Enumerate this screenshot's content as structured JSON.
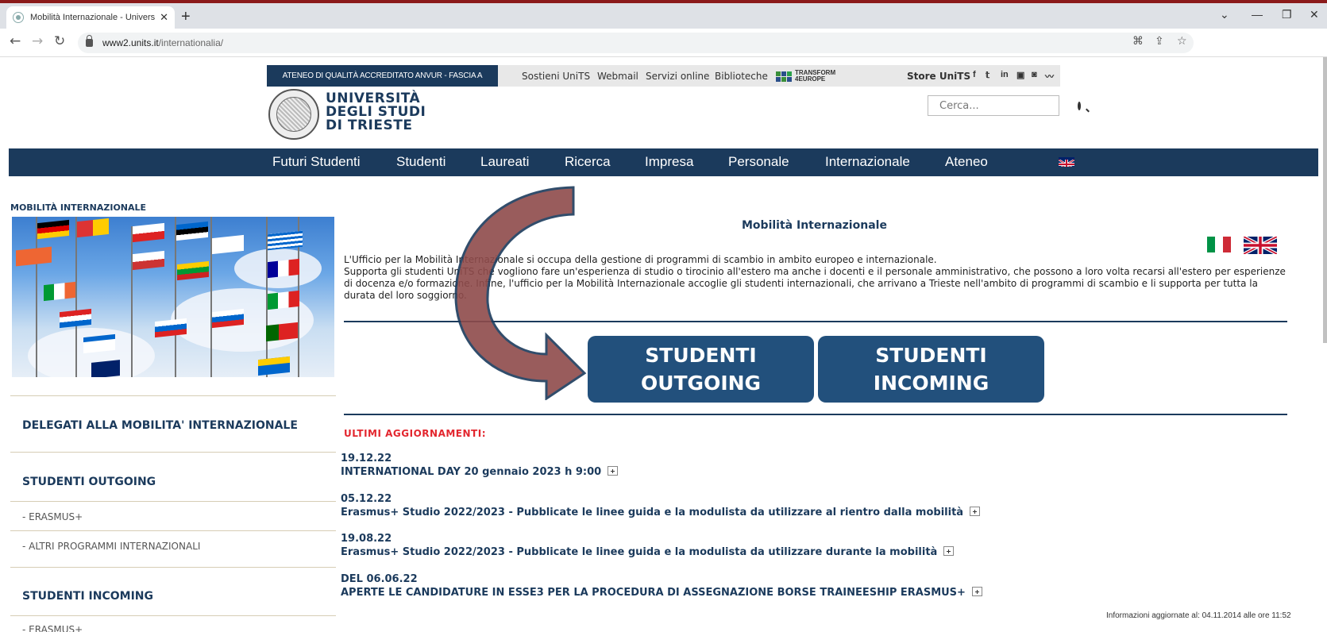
{
  "browser": {
    "tab_title": "Mobilità Internazionale - Univers",
    "url_host": "www2.units.it",
    "url_path": "/internationalia/"
  },
  "utility_bar": {
    "anvur": "ATENEO DI QUALITÀ ACCREDITATO ANVUR - FASCIA A",
    "links": [
      "Sostieni UniTS",
      "Webmail",
      "Servizi online",
      "Biblioteche"
    ],
    "transform_line1": "TRANSFORM",
    "transform_line2": "4EUROPE",
    "store": "Store UniTS"
  },
  "university": {
    "line1": "UNIVERSITÀ",
    "line2": "DEGLI STUDI",
    "line3": "DI TRIESTE"
  },
  "search": {
    "placeholder": "Cerca..."
  },
  "main_nav": [
    "Futuri Studenti",
    "Studenti",
    "Laureati",
    "Ricerca",
    "Impresa",
    "Personale",
    "Internazionale",
    "Ateneo"
  ],
  "sidebar": {
    "title": "MOBILITÀ INTERNAZIONALE",
    "delegati": "DELEGATI ALLA MOBILITA' INTERNAZIONALE",
    "outgoing": "STUDENTI OUTGOING",
    "outgoing_items": [
      "- ERASMUS+",
      "- ALTRI PROGRAMMI INTERNAZIONALI"
    ],
    "incoming": "STUDENTI INCOMING",
    "incoming_items": [
      "- ERASMUS+"
    ]
  },
  "content": {
    "title": "Mobilità Internazionale",
    "intro_p1": "L'Ufficio per la Mobilità Internazionale si occupa della gestione di programmi di scambio in ambito europeo e internazionale.",
    "intro_p2": "Supporta gli studenti UniTS che vogliono fare un'esperienza di studio o tirocinio all'estero ma anche i docenti e il personale amministrativo, che possono a loro volta recarsi all'estero per esperienze di docenza e/o formazione. Infine, l'ufficio per la Mobilità Internazionale accoglie gli studenti internazionali, che arrivano a Trieste nell'ambito di programmi di scambio e li supporta per tutta la durata del loro soggiorno.",
    "btn_outgoing_1": "STUDENTI",
    "btn_outgoing_2": "OUTGOING",
    "btn_incoming_1": "STUDENTI",
    "btn_incoming_2": "INCOMING",
    "updates_heading": "ULTIMI AGGIORNAMENTI:",
    "news": [
      {
        "date": "19.12.22",
        "text": "INTERNATIONAL DAY 20 gennaio 2023 h 9:00"
      },
      {
        "date": "05.12.22",
        "text": "Erasmus+ Studio 2022/2023 - Pubblicate le linee guida e la modulista da utilizzare al rientro dalla mobilità"
      },
      {
        "date": "19.08.22",
        "text": "Erasmus+ Studio 2022/2023 - Pubblicate le linee guida e la modulista da utilizzare durante la mobilità"
      },
      {
        "date": "DEL 06.06.22",
        "text": "APERTE LE CANDIDATURE IN ESSE3 PER LA PROCEDURA DI ASSEGNAZIONE BORSE TRAINEESHIP ERASMUS+"
      }
    ],
    "footer_info": "Informazioni aggiornate al: 04.11.2014 alle ore 11:52"
  },
  "colors": {
    "navy": "#1b3a5c",
    "button": "#22507c",
    "arrow": "#8f4b4b",
    "accent_red": "#e3262e"
  }
}
